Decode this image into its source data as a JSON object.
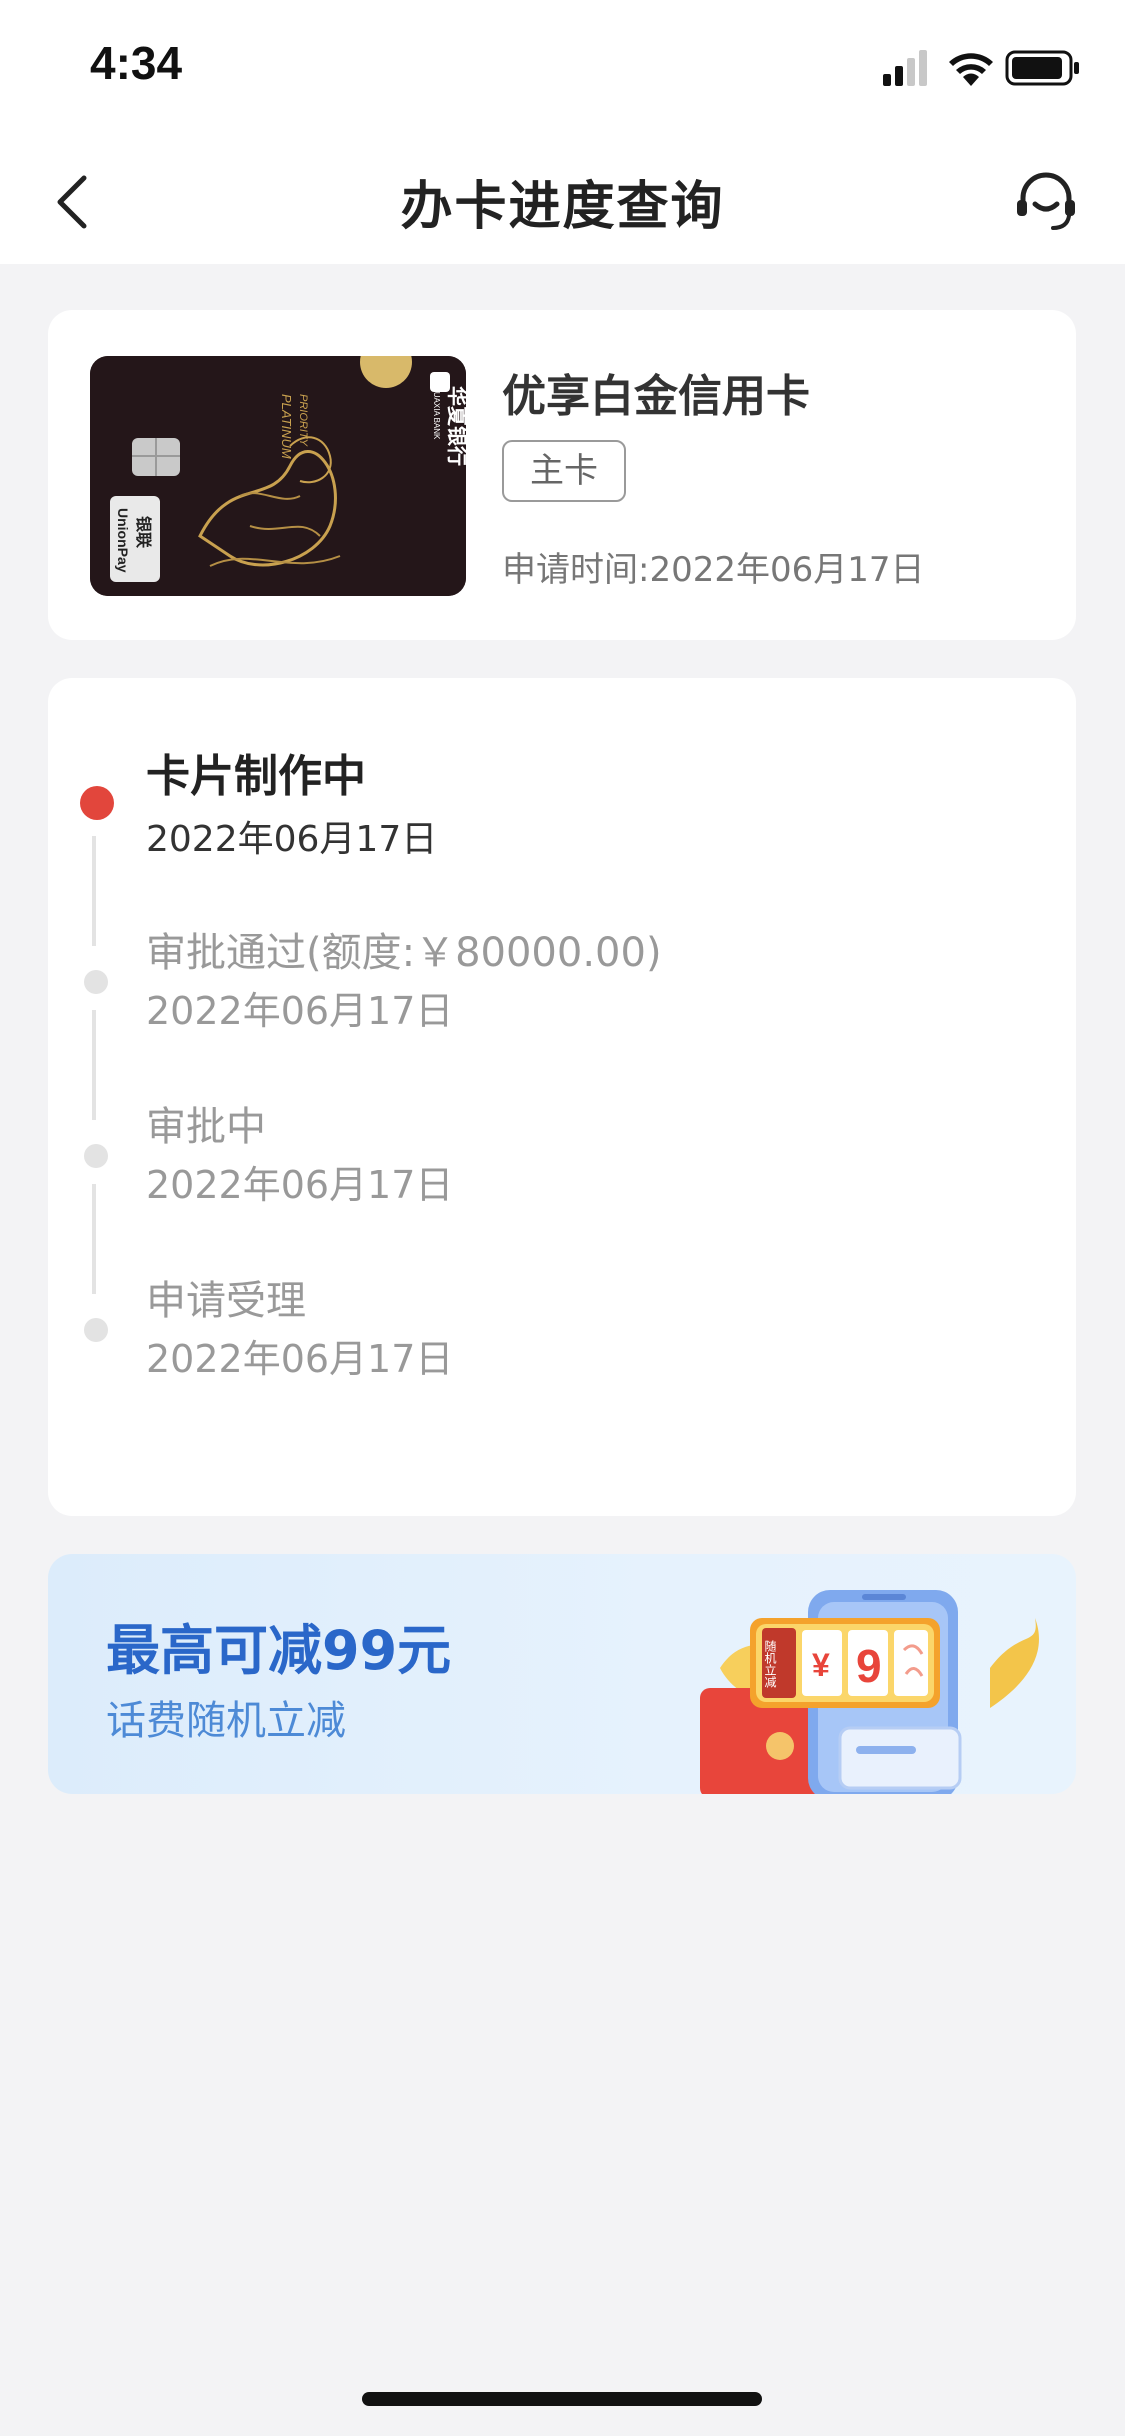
{
  "status_bar": {
    "time": "4:34"
  },
  "nav": {
    "title": "办卡进度查询",
    "back_icon": "chevron-left-icon",
    "service_icon": "customer-service-headset-icon"
  },
  "card_info": {
    "product_name": "优享白金信用卡",
    "card_type": "主卡",
    "apply_time": "申请时间:2022年06月17日",
    "card_image": {
      "bank_name": "华夏银行",
      "bank_name_en": "HUAXIA BANK",
      "tier": "PLATINUM",
      "tier_prefix": "PRIORITY",
      "network": "UnionPay",
      "network_cn": "银联"
    }
  },
  "progress": {
    "steps": [
      {
        "title": "卡片制作中",
        "date": "2022年06月17日",
        "active": true
      },
      {
        "title": "审批通过(额度:￥80000.00)",
        "date": "2022年06月17日",
        "active": false
      },
      {
        "title": "审批中",
        "date": "2022年06月17日",
        "active": false
      },
      {
        "title": "申请受理",
        "date": "2022年06月17日",
        "active": false
      }
    ]
  },
  "promo": {
    "title": "最高可减99元",
    "subtitle": "话费随机立减",
    "illustration": {
      "badge": "随机立减",
      "currency": "¥",
      "digit": "9"
    }
  },
  "colors": {
    "active_dot": "#e2463c",
    "promo_title": "#2a67c9",
    "promo_subtitle": "#4d8ad6",
    "background": "#f3f3f5"
  }
}
